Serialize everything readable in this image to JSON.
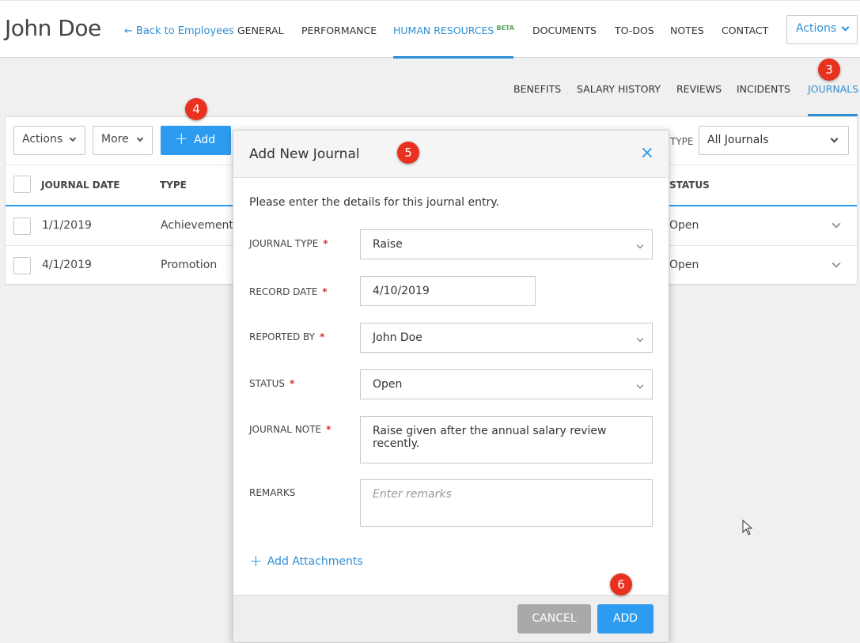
{
  "header": {
    "employee_name": "John Doe",
    "back_link": "Back to Employees",
    "nav": [
      "GENERAL",
      "PERFORMANCE",
      "HUMAN RESOURCES",
      "DOCUMENTS",
      "TO-DOs",
      "NOTES",
      "CONTACT"
    ],
    "beta_label": "BETA",
    "actions_label": "Actions"
  },
  "subtabs": [
    "BENEFITS",
    "SALARY HISTORY",
    "REVIEWS",
    "INCIDENTS",
    "JOURNALS"
  ],
  "badges": [
    "3",
    "4",
    "5",
    "6"
  ],
  "toolbar": {
    "actions_label": "Actions",
    "more_label": "More",
    "add_label": "Add",
    "type_label": "TYPE",
    "type_value": "All Journals"
  },
  "table": {
    "columns": [
      "JOURNAL DATE",
      "TYPE",
      "STATUS"
    ],
    "rows": [
      {
        "date": "1/1/2019",
        "type": "Achievement",
        "status": "Open"
      },
      {
        "date": "4/1/2019",
        "type": "Promotion",
        "status": "Open"
      }
    ]
  },
  "modal": {
    "title": "Add New Journal",
    "close_icon": "×",
    "intro": "Please enter the details for this journal entry.",
    "fields": {
      "journal_type": {
        "label": "JOURNAL TYPE",
        "value": "Raise"
      },
      "record_date": {
        "label": "RECORD DATE",
        "value": "4/10/2019"
      },
      "reported_by": {
        "label": "REPORTED BY",
        "value": "John Doe"
      },
      "status": {
        "label": "STATUS",
        "value": "Open"
      },
      "journal_note": {
        "label": "JOURNAL NOTE",
        "value": "Raise given after the annual salary review recently."
      },
      "remarks": {
        "label": "REMARKS",
        "placeholder": "Enter remarks"
      }
    },
    "required_mark": "*",
    "add_attachments": "Add Attachments",
    "cancel_label": "CANCEL",
    "submit_label": "ADD"
  },
  "colors": {
    "accent": "#2d9cf0",
    "badge": "#e8321f",
    "cancel": "#a8a9ab"
  }
}
